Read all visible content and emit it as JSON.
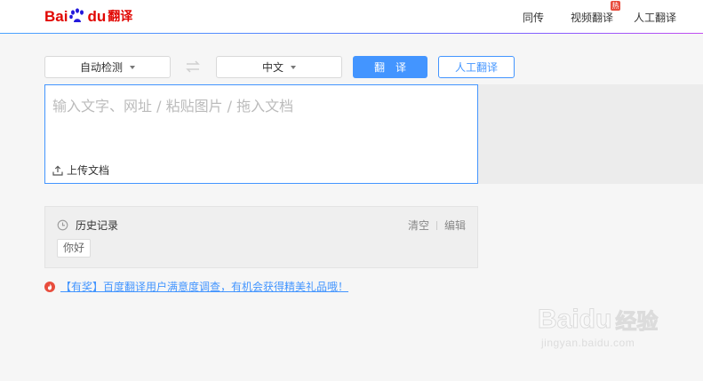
{
  "header": {
    "logo_bai": "Bai",
    "logo_du": "du",
    "logo_fanyi": "翻译",
    "nav": [
      {
        "label": "同传"
      },
      {
        "label": "视频翻译",
        "badge": "热"
      },
      {
        "label": "人工翻译"
      }
    ]
  },
  "toolbar": {
    "source_lang": "自动检测",
    "target_lang": "中文",
    "translate_label": "翻译",
    "human_translate_label": "人工翻译"
  },
  "input": {
    "placeholder": "输入文字、网址 / 粘贴图片 / 拖入文档",
    "upload_label": "上传文档"
  },
  "history": {
    "title": "历史记录",
    "clear_label": "清空",
    "edit_label": "编辑",
    "items": [
      "你好"
    ]
  },
  "promo": {
    "text": "【有奖】百度翻译用户满意度调查，有机会获得精美礼品哦！"
  },
  "watermark": {
    "brand": "Baidu",
    "brand_cn": "经验",
    "url": "jingyan.baidu.com"
  },
  "colors": {
    "accent": "#4395ff",
    "brand_red": "#e10601",
    "hot_badge": "#e84d3d"
  },
  "icons": [
    "baidu-paw-icon",
    "swap-icon",
    "upload-icon",
    "clock-icon",
    "fire-icon",
    "caret-down-icon"
  ]
}
